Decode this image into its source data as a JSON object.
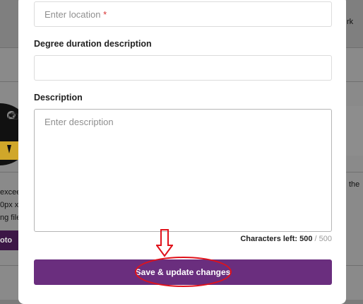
{
  "background": {
    "right_text_1": "rk",
    "right_text_2": "the",
    "left_lines": [
      "exceed",
      "0px x",
      "ng file"
    ],
    "photo_button_label": "oto"
  },
  "modal": {
    "location": {
      "placeholder": "Enter location",
      "required_mark": "*"
    },
    "degree_duration": {
      "label": "Degree duration description",
      "value": ""
    },
    "description": {
      "label": "Description",
      "placeholder": "Enter description"
    },
    "characters_left": {
      "label": "Characters left:",
      "remaining": "500",
      "max": "/ 500"
    },
    "save_button_label": "Save & update changes"
  },
  "annotation": {
    "color": "#e0121b"
  },
  "colors": {
    "primary_button": "#6a2e7e",
    "required": "#d83232"
  }
}
